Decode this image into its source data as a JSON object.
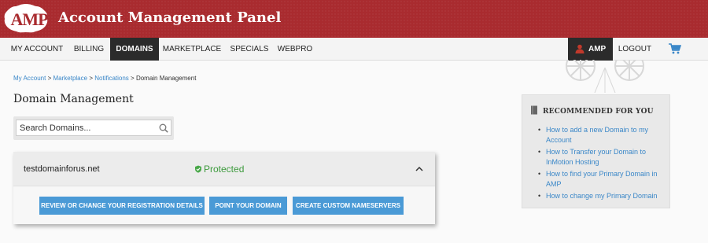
{
  "header": {
    "logo_text": "AMP",
    "title": "Account Management Panel"
  },
  "nav": {
    "items": [
      "MY ACCOUNT",
      "BILLING",
      "DOMAINS",
      "MARKETPLACE",
      "SPECIALS",
      "WEBPRO"
    ],
    "active": "DOMAINS",
    "user_label": "AMP",
    "logout_label": "LOGOUT"
  },
  "breadcrumb": {
    "links": [
      "My Account",
      "Marketplace",
      "Notifications"
    ],
    "separator": ">",
    "current": "Domain Management"
  },
  "page": {
    "title": "Domain Management"
  },
  "search": {
    "placeholder": "Search Domains..."
  },
  "domain_card": {
    "domain": "testdomainforus.net",
    "status": "Protected",
    "buttons": [
      "REVIEW OR CHANGE YOUR REGISTRATION DETAILS",
      "POINT YOUR DOMAIN",
      "CREATE CUSTOM NAMESERVERS"
    ]
  },
  "recommended": {
    "heading": "RECOMMENDED FOR YOU",
    "links": [
      "How to add a new Domain to my Account",
      "How to Transfer your Domain to InMotion Hosting",
      "How to find your Primary Domain in AMP",
      "How to change my Primary Domain"
    ]
  },
  "colors": {
    "header_bg": "#a92b2f",
    "nav_active_bg": "#2b2b2b",
    "button_bg": "#4a9ad6",
    "link": "#3a87c8",
    "status_green": "#3c9a3c"
  }
}
